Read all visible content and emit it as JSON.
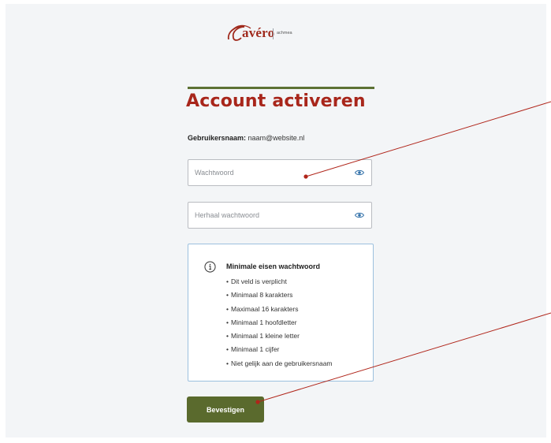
{
  "brand": {
    "name": "avéro",
    "sub": "achmea",
    "color": "#a02a1d"
  },
  "page": {
    "title": "Account activeren",
    "accent": "#5c7134"
  },
  "username": {
    "label": "Gebruikersnaam:",
    "value": "naam@website.nl"
  },
  "password_field": {
    "placeholder": "Wachtwoord",
    "value": "",
    "icon": "eye-icon"
  },
  "repeat_password_field": {
    "placeholder": "Herhaal wachtwoord",
    "value": "",
    "icon": "eye-icon"
  },
  "requirements": {
    "icon": "info-icon",
    "title": "Minimale eisen wachtwoord",
    "items": [
      "Dit veld is verplicht",
      "Minimaal 8 karakters",
      "Maximaal 16 karakters",
      "Minimaal 1 hoofdletter",
      "Minimaal 1 kleine letter",
      "Minimaal 1 cijfer",
      "Niet gelijk aan de gebruikersnaam"
    ]
  },
  "submit": {
    "label": "Bevestigen",
    "color": "#5a6a2d"
  },
  "annotation_color": "#b0251a"
}
